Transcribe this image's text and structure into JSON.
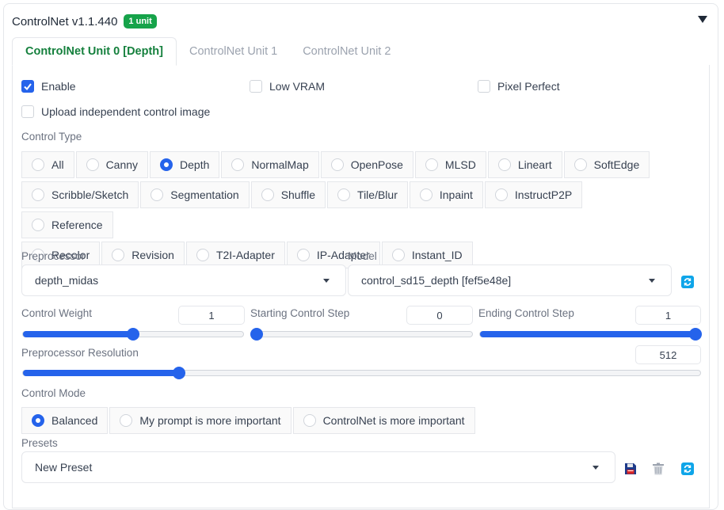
{
  "header": {
    "title": "ControlNet v1.1.440",
    "badge": "1 unit"
  },
  "tabs": [
    {
      "label": "ControlNet Unit 0 [Depth]",
      "active": true
    },
    {
      "label": "ControlNet Unit 1",
      "active": false
    },
    {
      "label": "ControlNet Unit 2",
      "active": false
    }
  ],
  "options": {
    "enable": {
      "label": "Enable",
      "checked": true
    },
    "low_vram": {
      "label": "Low VRAM",
      "checked": false
    },
    "pixel_perfect": {
      "label": "Pixel Perfect",
      "checked": false
    },
    "upload_independent": {
      "label": "Upload independent control image",
      "checked": false
    }
  },
  "control_type": {
    "label": "Control Type",
    "selected": "Depth",
    "items": [
      "All",
      "Canny",
      "Depth",
      "NormalMap",
      "OpenPose",
      "MLSD",
      "Lineart",
      "SoftEdge",
      "Scribble/Sketch",
      "Segmentation",
      "Shuffle",
      "Tile/Blur",
      "Inpaint",
      "InstructP2P",
      "Reference",
      "Recolor",
      "Revision",
      "T2I-Adapter",
      "IP-Adapter",
      "Instant_ID"
    ]
  },
  "preprocessor": {
    "label": "Preprocessor",
    "value": "depth_midas"
  },
  "model": {
    "label": "Model",
    "value": "control_sd15_depth [fef5e48e]"
  },
  "control_weight": {
    "label": "Control Weight",
    "value": "1",
    "fraction": 0.5
  },
  "starting_step": {
    "label": "Starting Control Step",
    "value": "0",
    "fraction": 0.0
  },
  "ending_step": {
    "label": "Ending Control Step",
    "value": "1",
    "fraction": 1.0
  },
  "preprocessor_resolution": {
    "label": "Preprocessor Resolution",
    "value": "512",
    "fraction": 0.23
  },
  "control_mode": {
    "label": "Control Mode",
    "selected": "Balanced",
    "items": [
      "Balanced",
      "My prompt is more important",
      "ControlNet is more important"
    ]
  },
  "presets": {
    "label": "Presets",
    "value": "New Preset"
  },
  "colors": {
    "accent": "#2563eb",
    "badge": "#16a34a",
    "active_tab": "#15803d",
    "refresh_icon": "#0ea5e9",
    "save_icon": "#1e3a8a",
    "trash_icon": "#9ca3af"
  }
}
